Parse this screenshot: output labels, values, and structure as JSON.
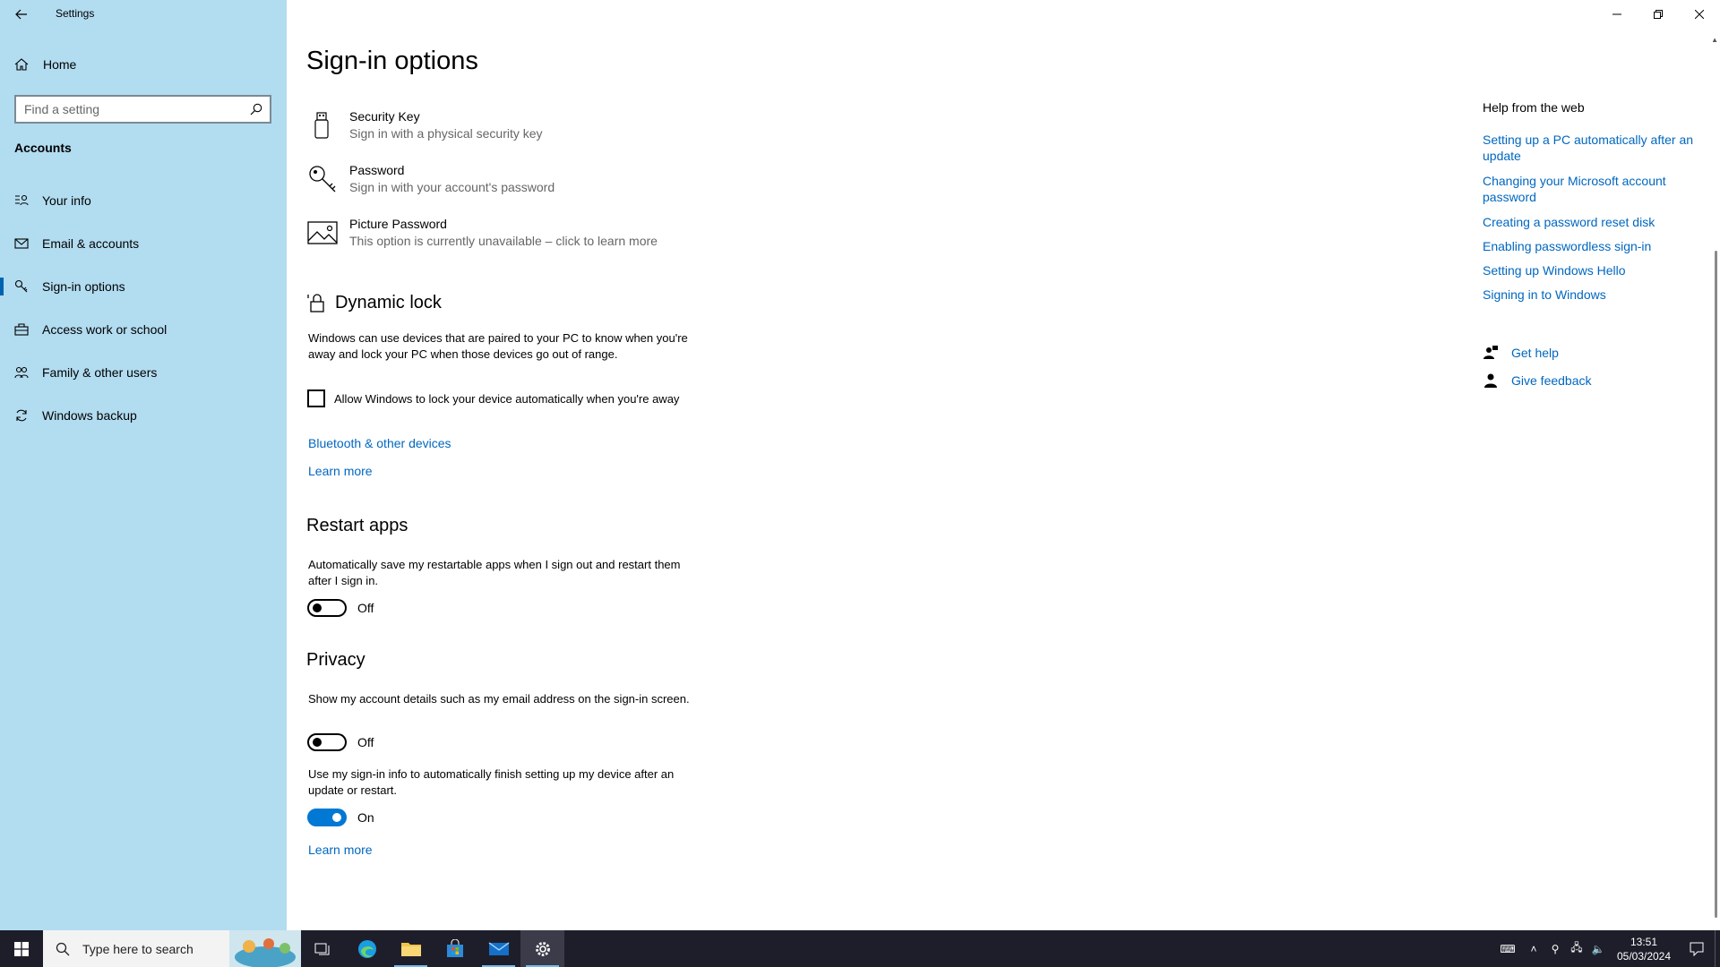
{
  "app": {
    "title": "Settings"
  },
  "sidebar": {
    "home_label": "Home",
    "search_placeholder": "Find a setting",
    "section": "Accounts",
    "items": [
      {
        "label": "Your info",
        "icon": "person-card-icon"
      },
      {
        "label": "Email & accounts",
        "icon": "mail-icon"
      },
      {
        "label": "Sign-in options",
        "icon": "key-icon",
        "selected": true
      },
      {
        "label": "Access work or school",
        "icon": "briefcase-icon"
      },
      {
        "label": "Family & other users",
        "icon": "people-icon"
      },
      {
        "label": "Windows backup",
        "icon": "sync-icon"
      }
    ]
  },
  "main": {
    "title": "Sign-in options",
    "options": [
      {
        "title": "Security Key",
        "subtitle": "Sign in with a physical security key",
        "icon": "usb-key-icon"
      },
      {
        "title": "Password",
        "subtitle": "Sign in with your account's password",
        "icon": "key-icon"
      },
      {
        "title": "Picture Password",
        "subtitle": "This option is currently unavailable – click to learn more",
        "icon": "picture-icon"
      }
    ],
    "dynamic_lock": {
      "heading": "Dynamic lock",
      "description": "Windows can use devices that are paired to your PC to know when you're away and lock your PC when those devices go out of range.",
      "checkbox_label": "Allow Windows to lock your device automatically when you're away",
      "checked": false,
      "link1": "Bluetooth & other devices",
      "link2": "Learn more"
    },
    "restart_apps": {
      "heading": "Restart apps",
      "description": "Automatically save my restartable apps when I sign out and restart them after I sign in.",
      "state": "Off"
    },
    "privacy": {
      "heading": "Privacy",
      "desc1": "Show my account details such as my email address on the sign-in screen.",
      "state1": "Off",
      "desc2": "Use my sign-in info to automatically finish setting up my device after an update or restart.",
      "state2": "On",
      "link": "Learn more"
    }
  },
  "help": {
    "heading": "Help from the web",
    "links": [
      "Setting up a PC automatically after an update",
      "Changing your Microsoft account password",
      "Creating a password reset disk",
      "Enabling passwordless sign-in",
      "Setting up Windows Hello",
      "Signing in to Windows"
    ],
    "get_help": "Get help",
    "give_feedback": "Give feedback"
  },
  "taskbar": {
    "search_placeholder": "Type here to search",
    "time": "13:51",
    "date": "05/03/2024",
    "colors": {
      "bg": "#1e1e2b",
      "accent": "#0078d4",
      "link": "#0067c0",
      "sidebar": "#b2dcf0"
    }
  }
}
